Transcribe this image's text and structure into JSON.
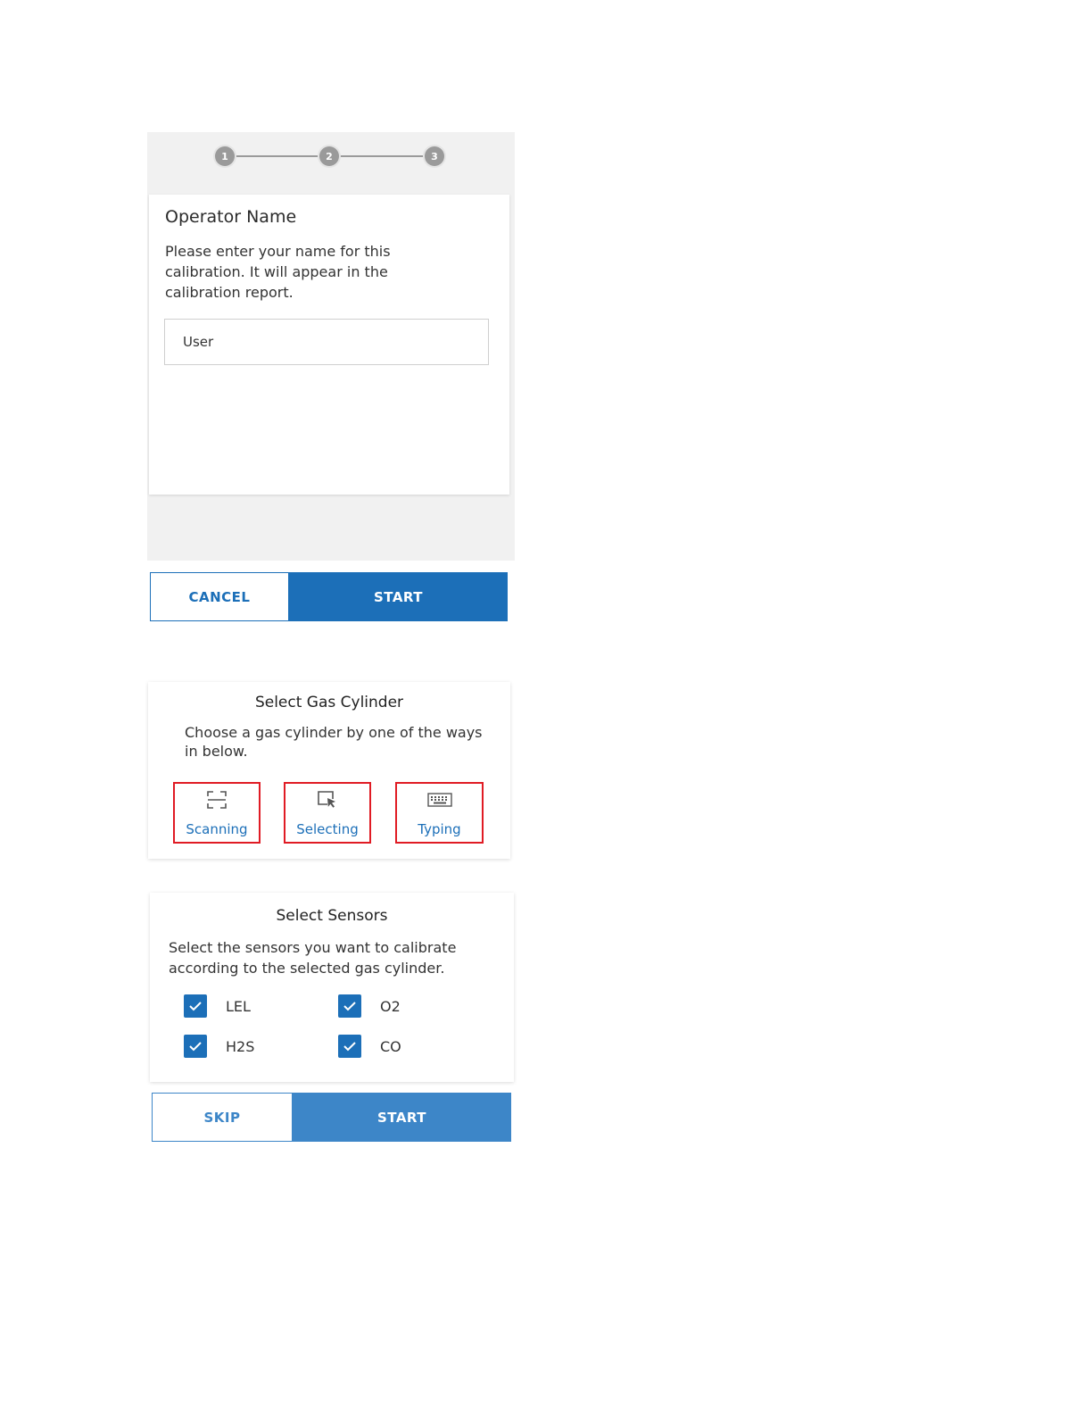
{
  "operator_screen": {
    "steps": [
      "1",
      "2",
      "3"
    ],
    "title": "Operator Name",
    "description": "Please enter your name for this calibration. It will appear in the calibration report.",
    "name_input_value": "User",
    "cancel_label": "CANCEL",
    "start_label": "START"
  },
  "gas_screen": {
    "title": "Select Gas Cylinder",
    "description": "Choose a gas cylinder by one of the ways in below.",
    "methods": [
      {
        "label": "Scanning",
        "icon": "scan-frame-icon"
      },
      {
        "label": "Selecting",
        "icon": "cursor-select-icon"
      },
      {
        "label": "Typing",
        "icon": "keyboard-icon"
      }
    ]
  },
  "sensors_screen": {
    "title": "Select Sensors",
    "description": "Select the sensors you want to calibrate according to the selected gas cylinder.",
    "sensors": [
      {
        "label": "LEL",
        "checked": true
      },
      {
        "label": "O2",
        "checked": true
      },
      {
        "label": "H2S",
        "checked": true
      },
      {
        "label": "CO",
        "checked": true
      }
    ],
    "skip_label": "SKIP",
    "start_label": "START"
  },
  "colors": {
    "accent": "#1c6fb8",
    "highlight_border": "#e01b24",
    "step_gray": "#9a9a9a"
  }
}
